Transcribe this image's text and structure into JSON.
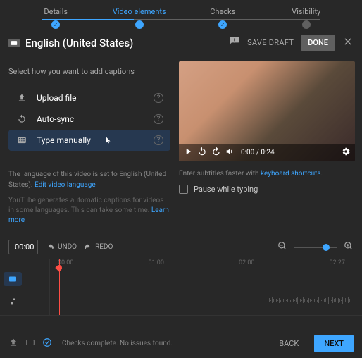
{
  "stepper": {
    "steps": [
      {
        "label": "Details",
        "state": "done"
      },
      {
        "label": "Video elements",
        "state": "active"
      },
      {
        "label": "Checks",
        "state": "done"
      },
      {
        "label": "Visibility",
        "state": "pending"
      }
    ]
  },
  "header": {
    "title": "English (United States)",
    "save_draft": "SAVE DRAFT",
    "done": "DONE"
  },
  "captions": {
    "prompt": "Select how you want to add captions",
    "options": {
      "upload": "Upload file",
      "auto_sync": "Auto-sync",
      "type_manually": "Type manually"
    }
  },
  "lang_note": {
    "prefix": "The language of this video is set to ",
    "lang": "English (United States)",
    "edit_link": "Edit video language"
  },
  "auto_note": {
    "text": "YouTube generates automatic captions for videos in some languages. This can take some time. ",
    "learn_more": "Learn more"
  },
  "player": {
    "time": "0:00 / 0:24"
  },
  "shortcuts": {
    "prefix": "Enter subtitles faster with ",
    "link": "keyboard shortcuts"
  },
  "pause_while_typing": "Pause while typing",
  "timeline_controls": {
    "time": "00:00",
    "undo": "UNDO",
    "redo": "REDO"
  },
  "timeline_ticks": [
    "00:00",
    "01:00",
    "02:00",
    "02:27"
  ],
  "footer": {
    "status": "Checks complete. No issues found.",
    "back": "BACK",
    "next": "NEXT"
  }
}
